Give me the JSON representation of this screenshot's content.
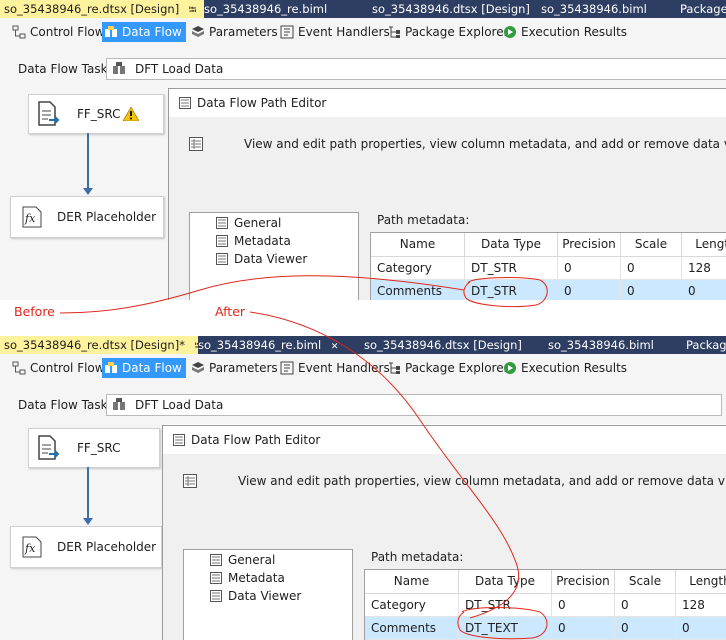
{
  "before": {
    "tabs": [
      {
        "label": "so_35438946_re.dtsx [Design]",
        "pin": "⭾",
        "active": true
      },
      {
        "label": "so_35438946_re.biml",
        "active": false
      },
      {
        "label": "so_35438946.dtsx [Design]",
        "active": false
      },
      {
        "label": "so_35438946.biml",
        "active": false
      },
      {
        "label": "Package",
        "active": false
      }
    ],
    "toolbar": [
      "Control Flow",
      "Data Flow",
      "Parameters",
      "Event Handlers",
      "Package Explorer",
      "Execution Results"
    ],
    "task_label": "Data Flow Task:",
    "task_value": "DFT Load Data",
    "nodes": {
      "source": "FF_SRC",
      "destination": "DER Placeholder"
    },
    "dialog": {
      "title": "Data Flow Path Editor",
      "description": "View and edit path properties, view column metadata, and add or remove data viewers from",
      "nav": [
        "General",
        "Metadata",
        "Data Viewer"
      ],
      "metadata_label": "Path metadata:",
      "headers": [
        "Name",
        "Data Type",
        "Precision",
        "Scale",
        "Length"
      ],
      "rows": [
        [
          "Category",
          "DT_STR",
          "0",
          "0",
          "128"
        ],
        [
          "Comments",
          "DT_STR",
          "0",
          "0",
          "0"
        ]
      ]
    }
  },
  "after": {
    "tabs": [
      {
        "label": "so_35438946_re.dtsx [Design]*",
        "pin": "⭾",
        "active": true
      },
      {
        "label": "so_35438946_re.biml",
        "pin": "✕",
        "active": false
      },
      {
        "label": "so_35438946.dtsx [Design]",
        "active": false
      },
      {
        "label": "so_35438946.biml",
        "active": false
      },
      {
        "label": "Packag",
        "active": false
      }
    ],
    "toolbar": [
      "Control Flow",
      "Data Flow",
      "Parameters",
      "Event Handlers",
      "Package Explorer",
      "Execution Results"
    ],
    "task_label": "Data Flow Task:",
    "task_value": "DFT Load Data",
    "nodes": {
      "source": "FF_SRC",
      "destination": "DER Placeholder"
    },
    "dialog": {
      "title": "Data Flow Path Editor",
      "description": "View and edit path properties, view column metadata, and add or remove data viewers from",
      "nav": [
        "General",
        "Metadata",
        "Data Viewer"
      ],
      "metadata_label": "Path metadata:",
      "headers": [
        "Name",
        "Data Type",
        "Precision",
        "Scale",
        "Length"
      ],
      "rows": [
        [
          "Category",
          "DT_STR",
          "0",
          "0",
          "128"
        ],
        [
          "Comments",
          "DT_TEXT",
          "0",
          "0",
          "0"
        ]
      ]
    }
  },
  "annotations": {
    "before": "Before",
    "after": "After",
    "color": "#e0271b"
  },
  "colors": {
    "tabbar": "#2d3e62",
    "active_tab": "#fff29d",
    "selected": "#3399ff",
    "row_highlight": "#cce8ff"
  }
}
